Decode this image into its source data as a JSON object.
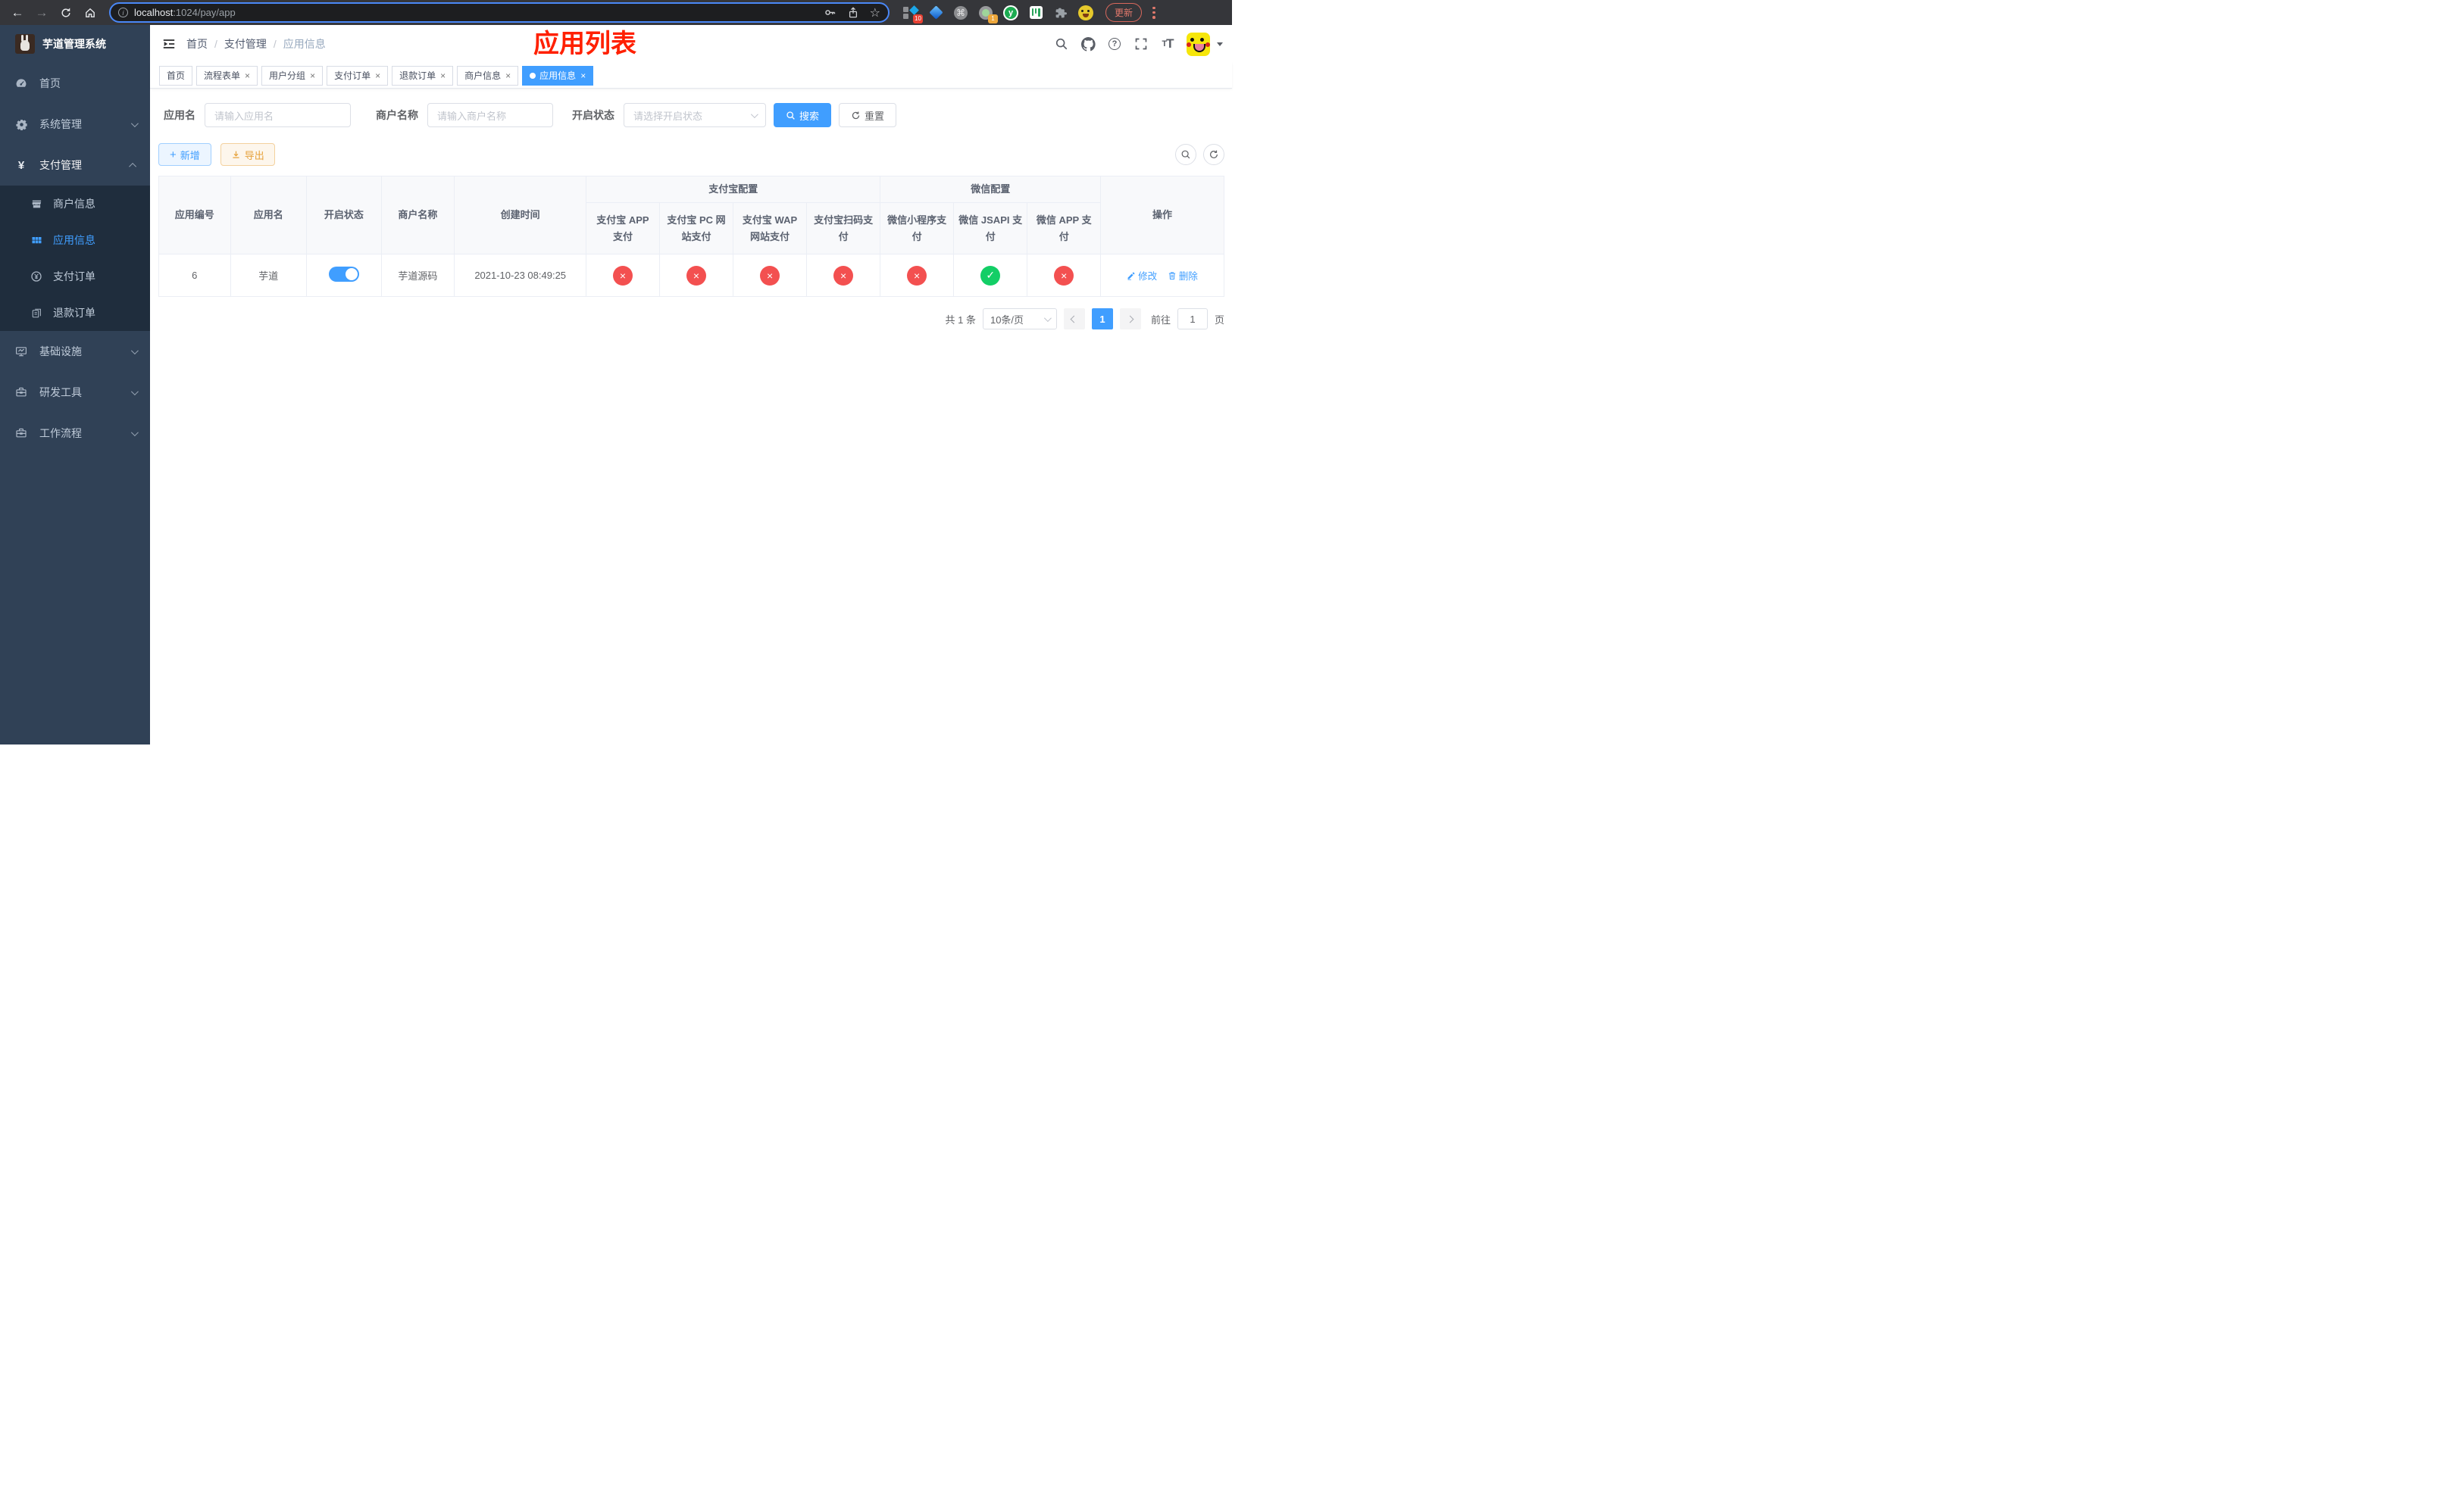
{
  "browser": {
    "url_host": "localhost",
    "url_path": ":1024/pay/app",
    "update_button": "更新",
    "ext_badge_sketch": "10",
    "ext_badge_recorder": "1",
    "ext_y_letter": "y"
  },
  "sidebar": {
    "title": "芋道管理系统",
    "menu": [
      {
        "label": "首页"
      },
      {
        "label": "系统管理"
      },
      {
        "label": "支付管理"
      },
      {
        "label": "商户信息"
      },
      {
        "label": "应用信息"
      },
      {
        "label": "支付订单"
      },
      {
        "label": "退款订单"
      },
      {
        "label": "基础设施"
      },
      {
        "label": "研发工具"
      },
      {
        "label": "工作流程"
      }
    ]
  },
  "navbar": {
    "breadcrumb": [
      "首页",
      "支付管理",
      "应用信息"
    ],
    "annotation": "应用列表"
  },
  "tabs": [
    {
      "label": "首页"
    },
    {
      "label": "流程表单"
    },
    {
      "label": "用户分组"
    },
    {
      "label": "支付订单"
    },
    {
      "label": "退款订单"
    },
    {
      "label": "商户信息"
    },
    {
      "label": "应用信息"
    }
  ],
  "filters": {
    "app_name_label": "应用名",
    "app_name_placeholder": "请输入应用名",
    "merchant_label": "商户名称",
    "merchant_placeholder": "请输入商户名称",
    "status_label": "开启状态",
    "status_placeholder": "请选择开启状态",
    "search_button": "搜索",
    "reset_button": "重置"
  },
  "toolbar": {
    "add_button": "新增",
    "export_button": "导出"
  },
  "table": {
    "col_id": "应用编号",
    "col_name": "应用名",
    "col_status": "开启状态",
    "col_merchant": "商户名称",
    "col_created": "创建时间",
    "group_alipay": {
      "label": "支付宝配置",
      "children": [
        "支付宝 APP 支付",
        "支付宝 PC 网站支付",
        "支付宝 WAP 网站支付",
        "支付宝扫码支付"
      ]
    },
    "group_wechat": {
      "label": "微信配置",
      "children": [
        "微信小程序支付",
        "微信 JSAPI 支付",
        "微信 APP 支付"
      ]
    },
    "col_action": "操作",
    "rows": [
      {
        "id": "6",
        "name": "芋道",
        "enabled": true,
        "merchant": "芋道源码",
        "created_at": "2021-10-23 08:49:25",
        "pay_status": [
          "no",
          "no",
          "no",
          "no",
          "no",
          "yes",
          "no"
        ],
        "edit_label": "修改",
        "delete_label": "删除"
      }
    ]
  },
  "pagination": {
    "total": "共 1 条",
    "per_page": "10条/页",
    "current_page": "1",
    "goto_label": "前往",
    "goto_value": "1",
    "goto_unit": "页"
  },
  "colors": {
    "accent": "#409eff",
    "sidebar_bg": "#304156",
    "submenu_bg": "#1f2d3d",
    "status_no": "#f35050",
    "status_yes": "#13ce66",
    "annotation_red": "#ff2000"
  }
}
